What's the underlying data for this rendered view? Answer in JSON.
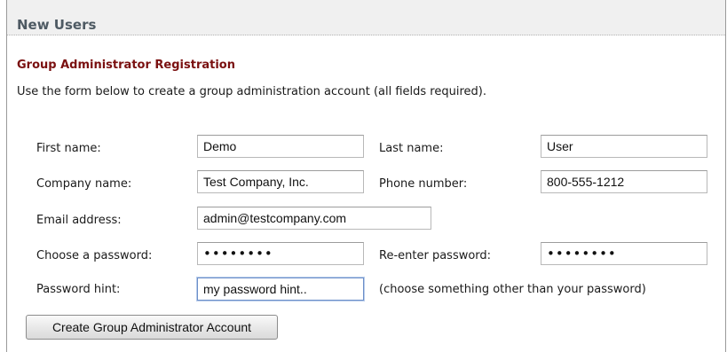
{
  "section": {
    "title": "New Users"
  },
  "form": {
    "heading": "Group Administrator Registration",
    "description": "Use the form below to create a group administration account (all fields required).",
    "fields": {
      "first_name": {
        "label": "First name:",
        "value": "Demo"
      },
      "last_name": {
        "label": "Last name:",
        "value": "User"
      },
      "company_name": {
        "label": "Company name:",
        "value": "Test Company, Inc."
      },
      "phone_number": {
        "label": "Phone number:",
        "value": "800-555-1212"
      },
      "email_address": {
        "label": "Email address:",
        "value": "admin@testcompany.com"
      },
      "password": {
        "label": "Choose a password:",
        "value": "••••••••"
      },
      "password_confirm": {
        "label": "Re-enter password:",
        "value": "••••••••"
      },
      "password_hint": {
        "label": "Password hint:",
        "value": "my password hint..",
        "note": "(choose something other than your password)"
      }
    },
    "submit_label": "Create Group Administrator Account"
  }
}
